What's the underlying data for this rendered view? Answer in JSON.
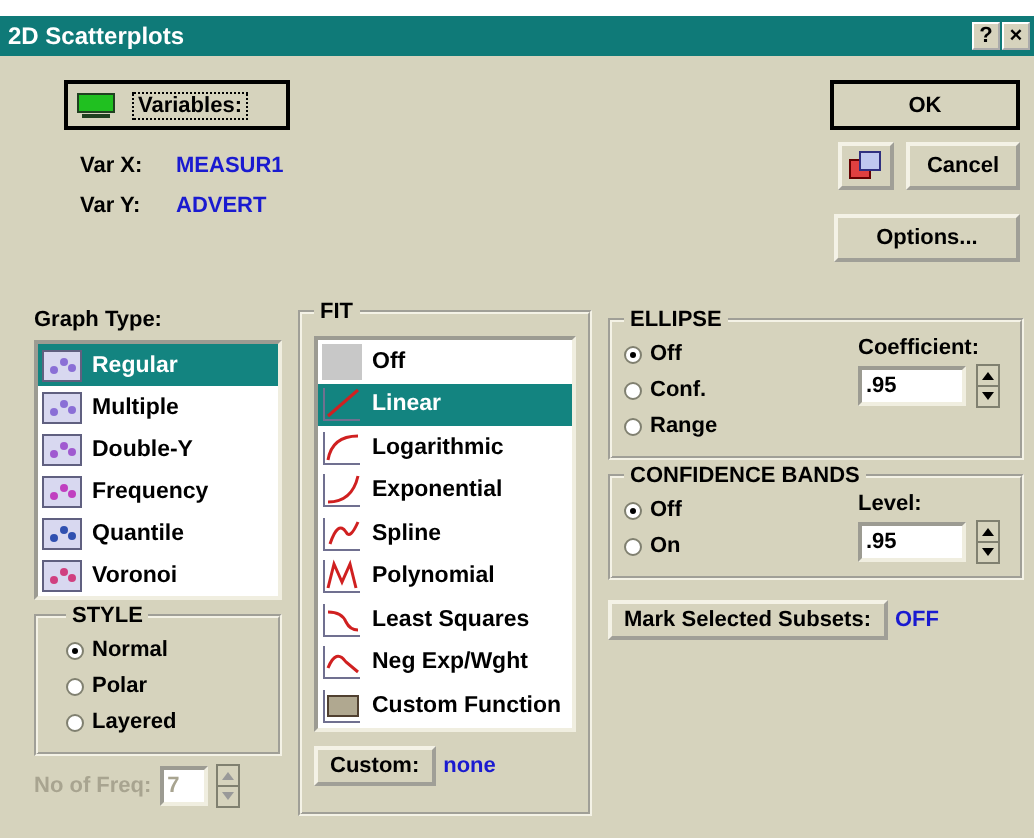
{
  "window": {
    "title": "2D Scatterplots",
    "help": "?",
    "close": "×"
  },
  "variables": {
    "button": "Variables:",
    "var_x_label": "Var X:",
    "var_x": "MEASUR1",
    "var_y_label": "Var Y:",
    "var_y": "ADVERT"
  },
  "buttons": {
    "ok": "OK",
    "cancel": "Cancel",
    "options": "Options..."
  },
  "graph_type": {
    "label": "Graph Type:",
    "items": [
      {
        "label": "Regular",
        "selected": true
      },
      {
        "label": "Multiple",
        "selected": false
      },
      {
        "label": "Double-Y",
        "selected": false
      },
      {
        "label": "Frequency",
        "selected": false
      },
      {
        "label": "Quantile",
        "selected": false
      },
      {
        "label": "Voronoi",
        "selected": false
      }
    ]
  },
  "style": {
    "title": "STYLE",
    "options": [
      {
        "label": "Normal",
        "selected": true
      },
      {
        "label": "Polar",
        "selected": false
      },
      {
        "label": "Layered",
        "selected": false
      }
    ]
  },
  "no_of_freq": {
    "label": "No of Freq:",
    "value": "7",
    "disabled": true
  },
  "fit": {
    "title": "FIT",
    "items": [
      {
        "label": "Off",
        "selected": false
      },
      {
        "label": "Linear",
        "selected": true
      },
      {
        "label": "Logarithmic",
        "selected": false
      },
      {
        "label": "Exponential",
        "selected": false
      },
      {
        "label": "Spline",
        "selected": false
      },
      {
        "label": "Polynomial",
        "selected": false
      },
      {
        "label": "Least Squares",
        "selected": false
      },
      {
        "label": "Neg Exp/Wght",
        "selected": false
      },
      {
        "label": "Custom Function",
        "selected": false
      }
    ],
    "custom_button": "Custom:",
    "custom_value": "none"
  },
  "ellipse": {
    "title": "ELLIPSE",
    "options": [
      {
        "label": "Off",
        "selected": true
      },
      {
        "label": "Conf.",
        "selected": false
      },
      {
        "label": "Range",
        "selected": false
      }
    ],
    "coefficient_label": "Coefficient:",
    "coefficient": ".95"
  },
  "confidence_bands": {
    "title": "CONFIDENCE BANDS",
    "options": [
      {
        "label": "Off",
        "selected": true
      },
      {
        "label": "On",
        "selected": false
      }
    ],
    "level_label": "Level:",
    "level": ".95"
  },
  "mark_subsets": {
    "button": "Mark Selected Subsets:",
    "value": "OFF"
  }
}
